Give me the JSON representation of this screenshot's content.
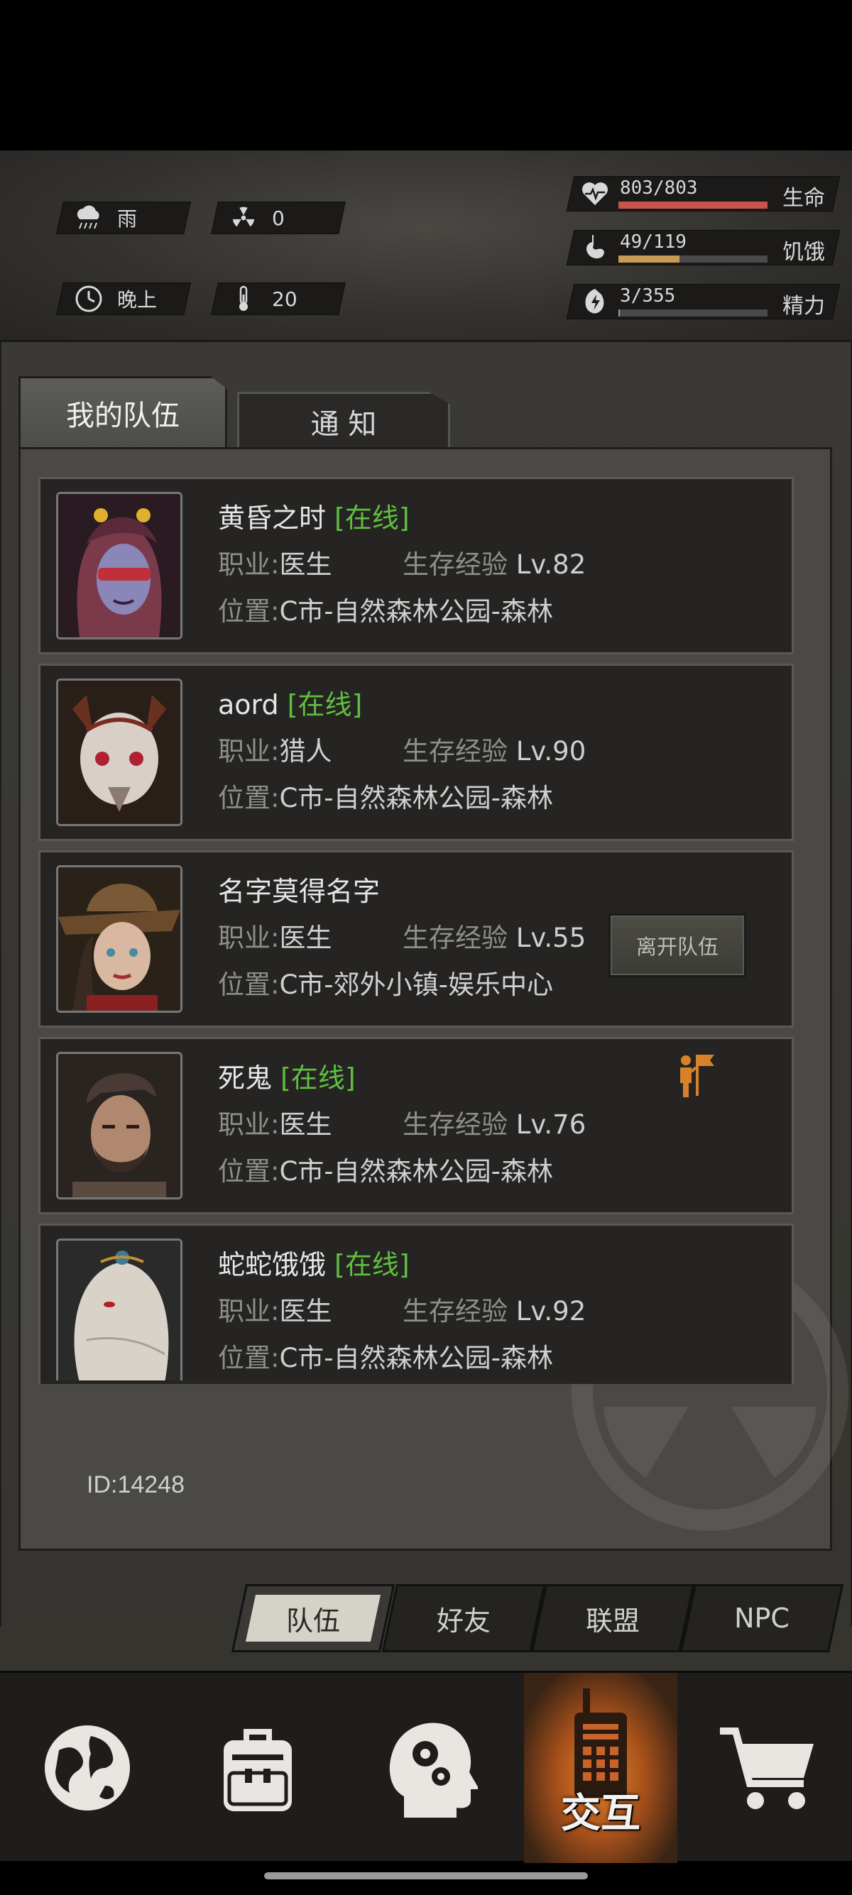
{
  "status": {
    "weather": "雨",
    "radiation": "0",
    "time_of_day": "晚上",
    "temperature": "20",
    "stats": [
      {
        "value": "803/803",
        "label": "生命",
        "fraction": 1.0,
        "color": "#c9554a",
        "icon": "heart-pulse-icon"
      },
      {
        "value": "49/119",
        "label": "饥饿",
        "fraction": 0.41,
        "color": "#c79a56",
        "icon": "stomach-icon"
      },
      {
        "value": "3/355",
        "label": "精力",
        "fraction": 0.01,
        "color": "#9a9a9a",
        "icon": "energy-icon"
      }
    ]
  },
  "tabs": {
    "team": "我的队伍",
    "notice": "通 知"
  },
  "members": [
    {
      "name": "黄昏之时",
      "online": "[在线]",
      "job_key": "职业:",
      "job": "医生",
      "exp_key": "生存经验",
      "exp": "Lv.82",
      "loc_key": "位置:",
      "location": "C市-自然森林公园-森林"
    },
    {
      "name": "aord",
      "online": "[在线]",
      "job_key": "职业:",
      "job": "猎人",
      "exp_key": "生存经验",
      "exp": "Lv.90",
      "loc_key": "位置:",
      "location": "C市-自然森林公园-森林"
    },
    {
      "name": "名字莫得名字",
      "online": "",
      "job_key": "职业:",
      "job": "医生",
      "exp_key": "生存经验",
      "exp": "Lv.55",
      "loc_key": "位置:",
      "location": "C市-郊外小镇-娱乐中心",
      "action": "离开队伍"
    },
    {
      "name": "死鬼",
      "online": "[在线]",
      "job_key": "职业:",
      "job": "医生",
      "exp_key": "生存经验",
      "exp": "Lv.76",
      "loc_key": "位置:",
      "location": "C市-自然森林公园-森林"
    },
    {
      "name": "蛇蛇饿饿",
      "online": "[在线]",
      "job_key": "职业:",
      "job": "医生",
      "exp_key": "生存经验",
      "exp": "Lv.92",
      "loc_key": "位置:",
      "location": "C市-自然森林公园-森林"
    }
  ],
  "user_id": "ID:14248",
  "bottom_tabs": [
    "队伍",
    "好友",
    "联盟",
    "NPC"
  ],
  "nav": {
    "interact_label": "交互"
  }
}
